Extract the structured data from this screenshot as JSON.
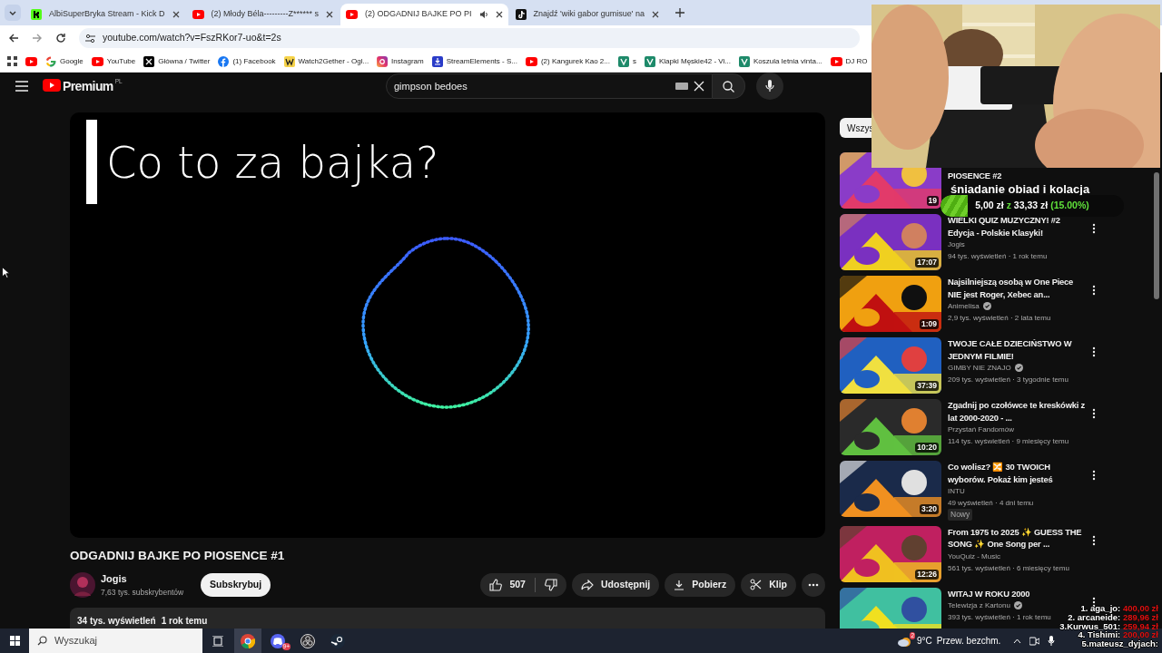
{
  "browser": {
    "tabs": [
      {
        "kind": "kick",
        "title": "AlbiSuperBryka Stream - Kick D",
        "selected": false,
        "audio": false
      },
      {
        "kind": "youtube",
        "title": "(2) Młody Béla---------Z****** s",
        "selected": false,
        "audio": false
      },
      {
        "kind": "youtube",
        "title": "(2) ODGADNIJ BAJKE PO PI",
        "selected": true,
        "audio": true
      },
      {
        "kind": "tiktok",
        "title": "Znajdź 'wiki gabor gumisue' na",
        "selected": false,
        "audio": false
      }
    ],
    "url": "youtube.com/watch?v=FszRKor7-uo&t=2s",
    "bookmarks": [
      {
        "kind": "youtube"
      },
      {
        "kind": "google",
        "label": "Google"
      },
      {
        "kind": "youtube",
        "label": "YouTube"
      },
      {
        "kind": "x",
        "label": "Główna / Twitter"
      },
      {
        "kind": "facebook",
        "label": "(1) Facebook"
      },
      {
        "kind": "w2g",
        "label": "Watch2Gether - Ogl..."
      },
      {
        "kind": "instagram",
        "label": "Instagram"
      },
      {
        "kind": "streamelements",
        "label": "StreamElements - S..."
      },
      {
        "kind": "youtube",
        "label": "(2) Kangurek Kao 2..."
      },
      {
        "kind": "tile",
        "label": "s"
      },
      {
        "kind": "tile",
        "label": "Klapki Męskie42 - Vi..."
      },
      {
        "kind": "tile",
        "label": "Koszula letnia vinta..."
      },
      {
        "kind": "youtube",
        "label": "DJ RO"
      }
    ]
  },
  "youtube": {
    "logo_label": "Premium",
    "region": "PL",
    "search": {
      "value": "gimpson bedoes"
    },
    "video": {
      "caption": "Co to za bajka?",
      "title": "ODGADNIJ BAJKE PO PIOSENCE #1",
      "channel": "Jogis",
      "subscribers": "7,63 tys. subskrybentów",
      "subscribe": "Subskrybuj",
      "likes": "507",
      "actions": [
        {
          "kind": "share",
          "label": "Udostępnij"
        },
        {
          "kind": "download",
          "label": "Pobierz"
        },
        {
          "kind": "clip",
          "label": "Klip"
        }
      ],
      "views": "34 tys. wyświetleń",
      "date": "1 rok temu"
    },
    "chips": [
      {
        "label": "Wszys",
        "selected": true
      }
    ],
    "related": [
      {
        "title": "PIOSENCE #2",
        "duration": "19"
      },
      {
        "title": "WIELKI QUIZ MUZYCZNY! #2 Edycja - Polskie Klasyki!",
        "channel": "Jogis",
        "verified": false,
        "meta": "94 tys. wyświetleń · 1 rok temu",
        "duration": "17:07"
      },
      {
        "title": "Najsilniejszą osobą w One Piece NIE jest Roger, Xebec an...",
        "channel": "Animelisa",
        "verified": true,
        "meta": "2,9 tys. wyświetleń · 2 lata temu",
        "duration": "1:09"
      },
      {
        "title": "TWOJE CAŁE DZIECIŃSTWO W JEDNYM FILMIE!",
        "channel": "GIMBY NIE ZNAJO",
        "verified": true,
        "meta": "209 tys. wyświetleń · 3 tygodnie temu",
        "duration": "37:39"
      },
      {
        "title": "Zgadnij po czołówce te kreskówki z lat 2000-2020 - ...",
        "channel": "Przystań Fandomów",
        "verified": false,
        "meta": "114 tys. wyświetleń · 9 miesięcy temu",
        "duration": "10:20"
      },
      {
        "title": "Co wolisz? 🔀 30 TWOICH wyborów. Pokaż kim jesteś",
        "channel": "INTU",
        "verified": false,
        "meta": "49 wyświetleń · 4 dni temu",
        "duration": "3:20",
        "badge": "Nowy"
      },
      {
        "title": "From 1975 to 2025 ✨ GUESS THE SONG ✨ One Song per ...",
        "channel": "YouQuiz - Music",
        "verified": false,
        "meta": "561 tys. wyświetleń · 6 miesięcy temu",
        "duration": "12:26"
      },
      {
        "title": "WITAJ W ROKU 2000",
        "channel": "Telewizja z Kartonu",
        "verified": true,
        "meta": "393 tys. wyświetleń · 1 rok temu"
      }
    ]
  },
  "overlays": {
    "goal": {
      "title": "śniadanie obiad i kolacja",
      "current": "5,00 zł",
      "separator": "z",
      "target": "33,33 zł",
      "percent": "(15.00%)",
      "level": 0.15
    },
    "leaderboard": [
      {
        "name": "1. aga_jo:",
        "amount": "400,00 zł"
      },
      {
        "name": "2. arcaneide:",
        "amount": "289,96 zł"
      },
      {
        "name": "3.Kurwus_501:",
        "amount": "259,94 zł"
      },
      {
        "name": "4. Tishimi:",
        "amount": "200,00 zł"
      },
      {
        "name": "5.mateusz_dyjach:"
      }
    ]
  },
  "taskbar": {
    "search_placeholder": "Wyszukaj",
    "apps": [
      {
        "kind": "chrome",
        "active": true
      },
      {
        "kind": "discord",
        "active": false,
        "badge": "9+"
      },
      {
        "kind": "obs",
        "active": false
      },
      {
        "kind": "steam",
        "active": false
      }
    ],
    "weather": {
      "badge": "2",
      "temperature": "9°C",
      "condition": "Przew. bezchm."
    }
  }
}
